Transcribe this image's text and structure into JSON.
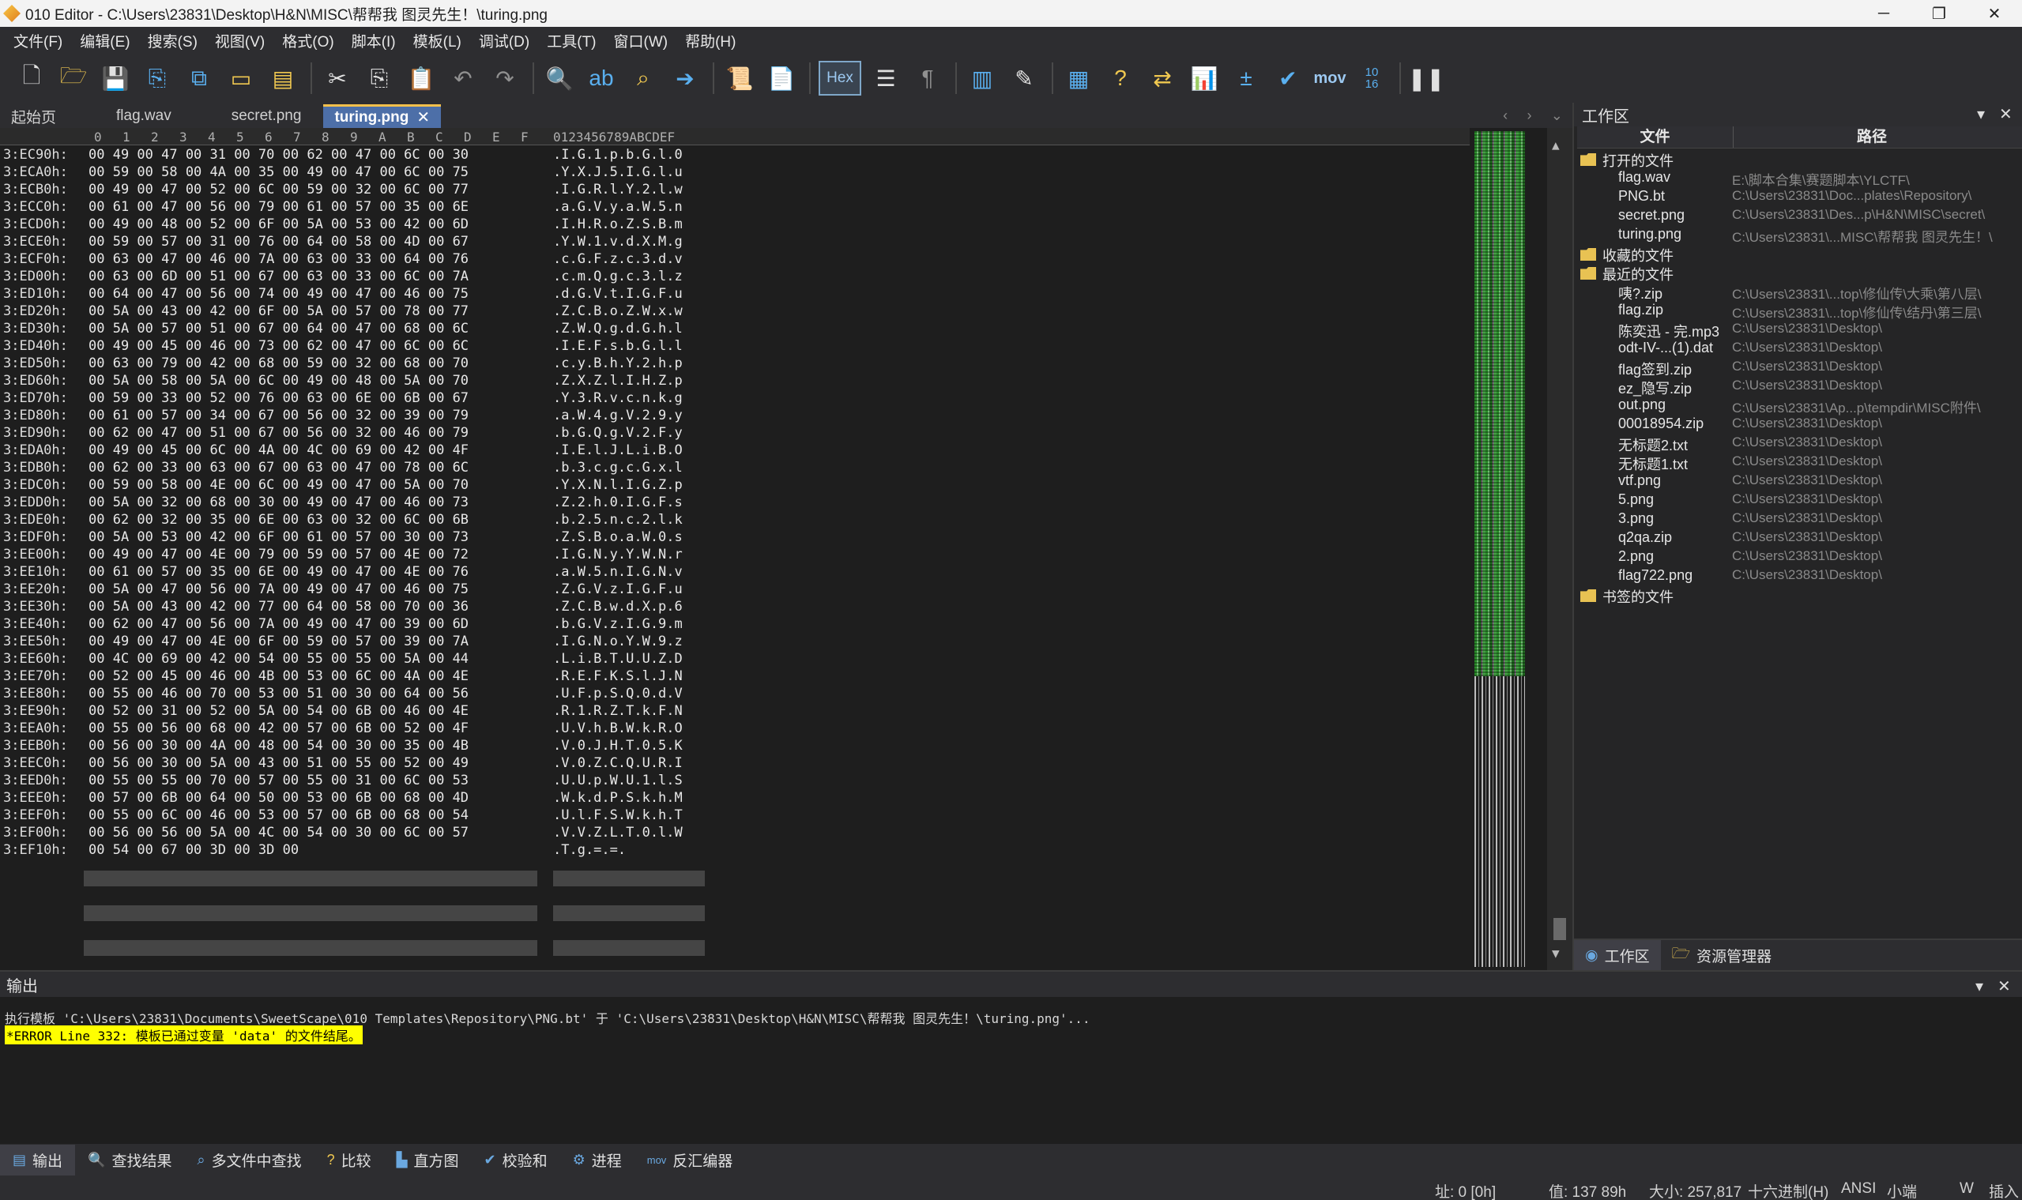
{
  "window": {
    "title": "010 Editor - C:\\Users\\23831\\Desktop\\H&N\\MISC\\帮帮我 图灵先生！\\turing.png",
    "minimize": "─",
    "maximize": "❐",
    "close": "✕"
  },
  "menu": [
    "文件(F)",
    "编辑(E)",
    "搜索(S)",
    "视图(V)",
    "格式(O)",
    "脚本(I)",
    "模板(L)",
    "调试(D)",
    "工具(T)",
    "窗口(W)",
    "帮助(H)"
  ],
  "toolbar": {
    "hex_label": "Hex",
    "mov_label": "mov",
    "base_label_top": "10",
    "base_label_bottom": "16"
  },
  "tabs": [
    {
      "label": "起始页",
      "active": false
    },
    {
      "label": "flag.wav",
      "active": false
    },
    {
      "label": "secret.png",
      "active": false
    },
    {
      "label": "turing.png",
      "active": true
    }
  ],
  "tab_close": "✕",
  "tab_nav": {
    "prev": "‹",
    "next": "›",
    "menu": "⌄"
  },
  "hex": {
    "col_headers": [
      "0",
      "1",
      "2",
      "3",
      "4",
      "5",
      "6",
      "7",
      "8",
      "9",
      "A",
      "B",
      "C",
      "D",
      "E",
      "F"
    ],
    "ascii_header": "0123456789ABCDEF",
    "rows": [
      {
        "addr": "3:EC90h:",
        "bytes": "00 49 00 47 00 31 00 70 00 62 00 47 00 6C 00 30",
        "ascii": ".I.G.1.p.b.G.l.0"
      },
      {
        "addr": "3:ECA0h:",
        "bytes": "00 59 00 58 00 4A 00 35 00 49 00 47 00 6C 00 75",
        "ascii": ".Y.X.J.5.I.G.l.u"
      },
      {
        "addr": "3:ECB0h:",
        "bytes": "00 49 00 47 00 52 00 6C 00 59 00 32 00 6C 00 77",
        "ascii": ".I.G.R.l.Y.2.l.w"
      },
      {
        "addr": "3:ECC0h:",
        "bytes": "00 61 00 47 00 56 00 79 00 61 00 57 00 35 00 6E",
        "ascii": ".a.G.V.y.a.W.5.n"
      },
      {
        "addr": "3:ECD0h:",
        "bytes": "00 49 00 48 00 52 00 6F 00 5A 00 53 00 42 00 6D",
        "ascii": ".I.H.R.o.Z.S.B.m"
      },
      {
        "addr": "3:ECE0h:",
        "bytes": "00 59 00 57 00 31 00 76 00 64 00 58 00 4D 00 67",
        "ascii": ".Y.W.1.v.d.X.M.g"
      },
      {
        "addr": "3:ECF0h:",
        "bytes": "00 63 00 47 00 46 00 7A 00 63 00 33 00 64 00 76",
        "ascii": ".c.G.F.z.c.3.d.v"
      },
      {
        "addr": "3:ED00h:",
        "bytes": "00 63 00 6D 00 51 00 67 00 63 00 33 00 6C 00 7A",
        "ascii": ".c.m.Q.g.c.3.l.z"
      },
      {
        "addr": "3:ED10h:",
        "bytes": "00 64 00 47 00 56 00 74 00 49 00 47 00 46 00 75",
        "ascii": ".d.G.V.t.I.G.F.u"
      },
      {
        "addr": "3:ED20h:",
        "bytes": "00 5A 00 43 00 42 00 6F 00 5A 00 57 00 78 00 77",
        "ascii": ".Z.C.B.o.Z.W.x.w"
      },
      {
        "addr": "3:ED30h:",
        "bytes": "00 5A 00 57 00 51 00 67 00 64 00 47 00 68 00 6C",
        "ascii": ".Z.W.Q.g.d.G.h.l"
      },
      {
        "addr": "3:ED40h:",
        "bytes": "00 49 00 45 00 46 00 73 00 62 00 47 00 6C 00 6C",
        "ascii": ".I.E.F.s.b.G.l.l"
      },
      {
        "addr": "3:ED50h:",
        "bytes": "00 63 00 79 00 42 00 68 00 59 00 32 00 68 00 70",
        "ascii": ".c.y.B.h.Y.2.h.p"
      },
      {
        "addr": "3:ED60h:",
        "bytes": "00 5A 00 58 00 5A 00 6C 00 49 00 48 00 5A 00 70",
        "ascii": ".Z.X.Z.l.I.H.Z.p"
      },
      {
        "addr": "3:ED70h:",
        "bytes": "00 59 00 33 00 52 00 76 00 63 00 6E 00 6B 00 67",
        "ascii": ".Y.3.R.v.c.n.k.g"
      },
      {
        "addr": "3:ED80h:",
        "bytes": "00 61 00 57 00 34 00 67 00 56 00 32 00 39 00 79",
        "ascii": ".a.W.4.g.V.2.9.y"
      },
      {
        "addr": "3:ED90h:",
        "bytes": "00 62 00 47 00 51 00 67 00 56 00 32 00 46 00 79",
        "ascii": ".b.G.Q.g.V.2.F.y"
      },
      {
        "addr": "3:EDA0h:",
        "bytes": "00 49 00 45 00 6C 00 4A 00 4C 00 69 00 42 00 4F",
        "ascii": ".I.E.l.J.L.i.B.O"
      },
      {
        "addr": "3:EDB0h:",
        "bytes": "00 62 00 33 00 63 00 67 00 63 00 47 00 78 00 6C",
        "ascii": ".b.3.c.g.c.G.x.l"
      },
      {
        "addr": "3:EDC0h:",
        "bytes": "00 59 00 58 00 4E 00 6C 00 49 00 47 00 5A 00 70",
        "ascii": ".Y.X.N.l.I.G.Z.p"
      },
      {
        "addr": "3:EDD0h:",
        "bytes": "00 5A 00 32 00 68 00 30 00 49 00 47 00 46 00 73",
        "ascii": ".Z.2.h.0.I.G.F.s"
      },
      {
        "addr": "3:EDE0h:",
        "bytes": "00 62 00 32 00 35 00 6E 00 63 00 32 00 6C 00 6B",
        "ascii": ".b.2.5.n.c.2.l.k"
      },
      {
        "addr": "3:EDF0h:",
        "bytes": "00 5A 00 53 00 42 00 6F 00 61 00 57 00 30 00 73",
        "ascii": ".Z.S.B.o.a.W.0.s"
      },
      {
        "addr": "3:EE00h:",
        "bytes": "00 49 00 47 00 4E 00 79 00 59 00 57 00 4E 00 72",
        "ascii": ".I.G.N.y.Y.W.N.r"
      },
      {
        "addr": "3:EE10h:",
        "bytes": "00 61 00 57 00 35 00 6E 00 49 00 47 00 4E 00 76",
        "ascii": ".a.W.5.n.I.G.N.v"
      },
      {
        "addr": "3:EE20h:",
        "bytes": "00 5A 00 47 00 56 00 7A 00 49 00 47 00 46 00 75",
        "ascii": ".Z.G.V.z.I.G.F.u"
      },
      {
        "addr": "3:EE30h:",
        "bytes": "00 5A 00 43 00 42 00 77 00 64 00 58 00 70 00 36",
        "ascii": ".Z.C.B.w.d.X.p.6"
      },
      {
        "addr": "3:EE40h:",
        "bytes": "00 62 00 47 00 56 00 7A 00 49 00 47 00 39 00 6D",
        "ascii": ".b.G.V.z.I.G.9.m"
      },
      {
        "addr": "3:EE50h:",
        "bytes": "00 49 00 47 00 4E 00 6F 00 59 00 57 00 39 00 7A",
        "ascii": ".I.G.N.o.Y.W.9.z"
      },
      {
        "addr": "3:EE60h:",
        "bytes": "00 4C 00 69 00 42 00 54 00 55 00 55 00 5A 00 44",
        "ascii": ".L.i.B.T.U.U.Z.D"
      },
      {
        "addr": "3:EE70h:",
        "bytes": "00 52 00 45 00 46 00 4B 00 53 00 6C 00 4A 00 4E",
        "ascii": ".R.E.F.K.S.l.J.N"
      },
      {
        "addr": "3:EE80h:",
        "bytes": "00 55 00 46 00 70 00 53 00 51 00 30 00 64 00 56",
        "ascii": ".U.F.p.S.Q.0.d.V"
      },
      {
        "addr": "3:EE90h:",
        "bytes": "00 52 00 31 00 52 00 5A 00 54 00 6B 00 46 00 4E",
        "ascii": ".R.1.R.Z.T.k.F.N"
      },
      {
        "addr": "3:EEA0h:",
        "bytes": "00 55 00 56 00 68 00 42 00 57 00 6B 00 52 00 4F",
        "ascii": ".U.V.h.B.W.k.R.O"
      },
      {
        "addr": "3:EEB0h:",
        "bytes": "00 56 00 30 00 4A 00 48 00 54 00 30 00 35 00 4B",
        "ascii": ".V.0.J.H.T.0.5.K"
      },
      {
        "addr": "3:EEC0h:",
        "bytes": "00 56 00 30 00 5A 00 43 00 51 00 55 00 52 00 49",
        "ascii": ".V.0.Z.C.Q.U.R.I"
      },
      {
        "addr": "3:EED0h:",
        "bytes": "00 55 00 55 00 70 00 57 00 55 00 31 00 6C 00 53",
        "ascii": ".U.U.p.W.U.1.l.S"
      },
      {
        "addr": "3:EEE0h:",
        "bytes": "00 57 00 6B 00 64 00 50 00 53 00 6B 00 68 00 4D",
        "ascii": ".W.k.d.P.S.k.h.M"
      },
      {
        "addr": "3:EEF0h:",
        "bytes": "00 55 00 6C 00 46 00 53 00 57 00 6B 00 68 00 54",
        "ascii": ".U.l.F.S.W.k.h.T"
      },
      {
        "addr": "3:EF00h:",
        "bytes": "00 56 00 56 00 5A 00 4C 00 54 00 30 00 6C 00 57",
        "ascii": ".V.V.Z.L.T.0.l.W"
      },
      {
        "addr": "3:EF10h:",
        "bytes": "00 54 00 67 00 3D 00 3D 00",
        "ascii": ".T.g.=.=."
      }
    ]
  },
  "workspace": {
    "title": "工作区",
    "col_file": "文件",
    "col_path": "路径",
    "groups": [
      {
        "label": "打开的文件",
        "items": [
          {
            "name": "flag.wav",
            "path": "E:\\脚本合集\\赛题脚本\\YLCTF\\"
          },
          {
            "name": "PNG.bt",
            "path": "C:\\Users\\23831\\Doc...plates\\Repository\\"
          },
          {
            "name": "secret.png",
            "path": "C:\\Users\\23831\\Des...p\\H&N\\MISC\\secret\\"
          },
          {
            "name": "turing.png",
            "path": "C:\\Users\\23831\\...MISC\\帮帮我 图灵先生！\\"
          }
        ]
      },
      {
        "label": "收藏的文件",
        "items": []
      },
      {
        "label": "最近的文件",
        "items": [
          {
            "name": "咦?.zip",
            "path": "C:\\Users\\23831\\...top\\修仙传\\大乘\\第八层\\"
          },
          {
            "name": "flag.zip",
            "path": "C:\\Users\\23831\\...top\\修仙传\\结丹\\第三层\\"
          },
          {
            "name": "陈奕迅 - 完.mp3",
            "path": "C:\\Users\\23831\\Desktop\\"
          },
          {
            "name": "odt-IV-...(1).dat",
            "path": "C:\\Users\\23831\\Desktop\\"
          },
          {
            "name": "flag签到.zip",
            "path": "C:\\Users\\23831\\Desktop\\"
          },
          {
            "name": "ez_隐写.zip",
            "path": "C:\\Users\\23831\\Desktop\\"
          },
          {
            "name": "out.png",
            "path": "C:\\Users\\23831\\Ap...p\\tempdir\\MISC附件\\"
          },
          {
            "name": "00018954.zip",
            "path": "C:\\Users\\23831\\Desktop\\"
          },
          {
            "name": "无标题2.txt",
            "path": "C:\\Users\\23831\\Desktop\\"
          },
          {
            "name": "无标题1.txt",
            "path": "C:\\Users\\23831\\Desktop\\"
          },
          {
            "name": "vtf.png",
            "path": "C:\\Users\\23831\\Desktop\\"
          },
          {
            "name": "5.png",
            "path": "C:\\Users\\23831\\Desktop\\"
          },
          {
            "name": "3.png",
            "path": "C:\\Users\\23831\\Desktop\\"
          },
          {
            "name": "q2qa.zip",
            "path": "C:\\Users\\23831\\Desktop\\"
          },
          {
            "name": "2.png",
            "path": "C:\\Users\\23831\\Desktop\\"
          },
          {
            "name": "flag722.png",
            "path": "C:\\Users\\23831\\Desktop\\"
          }
        ]
      },
      {
        "label": "书签的文件",
        "items": []
      }
    ],
    "footer_tabs": [
      "工作区",
      "资源管理器"
    ]
  },
  "output": {
    "title": "输出",
    "line1": "执行模板 'C:\\Users\\23831\\Documents\\SweetScape\\010 Templates\\Repository\\PNG.bt' 于 'C:\\Users\\23831\\Desktop\\H&N\\MISC\\帮帮我 图灵先生！\\turing.png'...",
    "line2": "*ERROR Line 332: 模板已通过变量 'data' 的文件结尾。",
    "tabs": [
      "输出",
      "查找结果",
      "多文件中查找",
      "比较",
      "直方图",
      "校验和",
      "进程",
      "反汇编器"
    ]
  },
  "status": {
    "addr": "址: 0 [0h]",
    "value": "值: 137 89h",
    "size": "大小: 257,817",
    "mode": "十六进制(H)",
    "encoding": "ANSI",
    "endian": "小端",
    "w": "W",
    "insert": "插入"
  },
  "colors": {
    "accent": "#4d6fa8",
    "tab_highlight": "#f5c04b",
    "error_bg": "#ffff00"
  }
}
